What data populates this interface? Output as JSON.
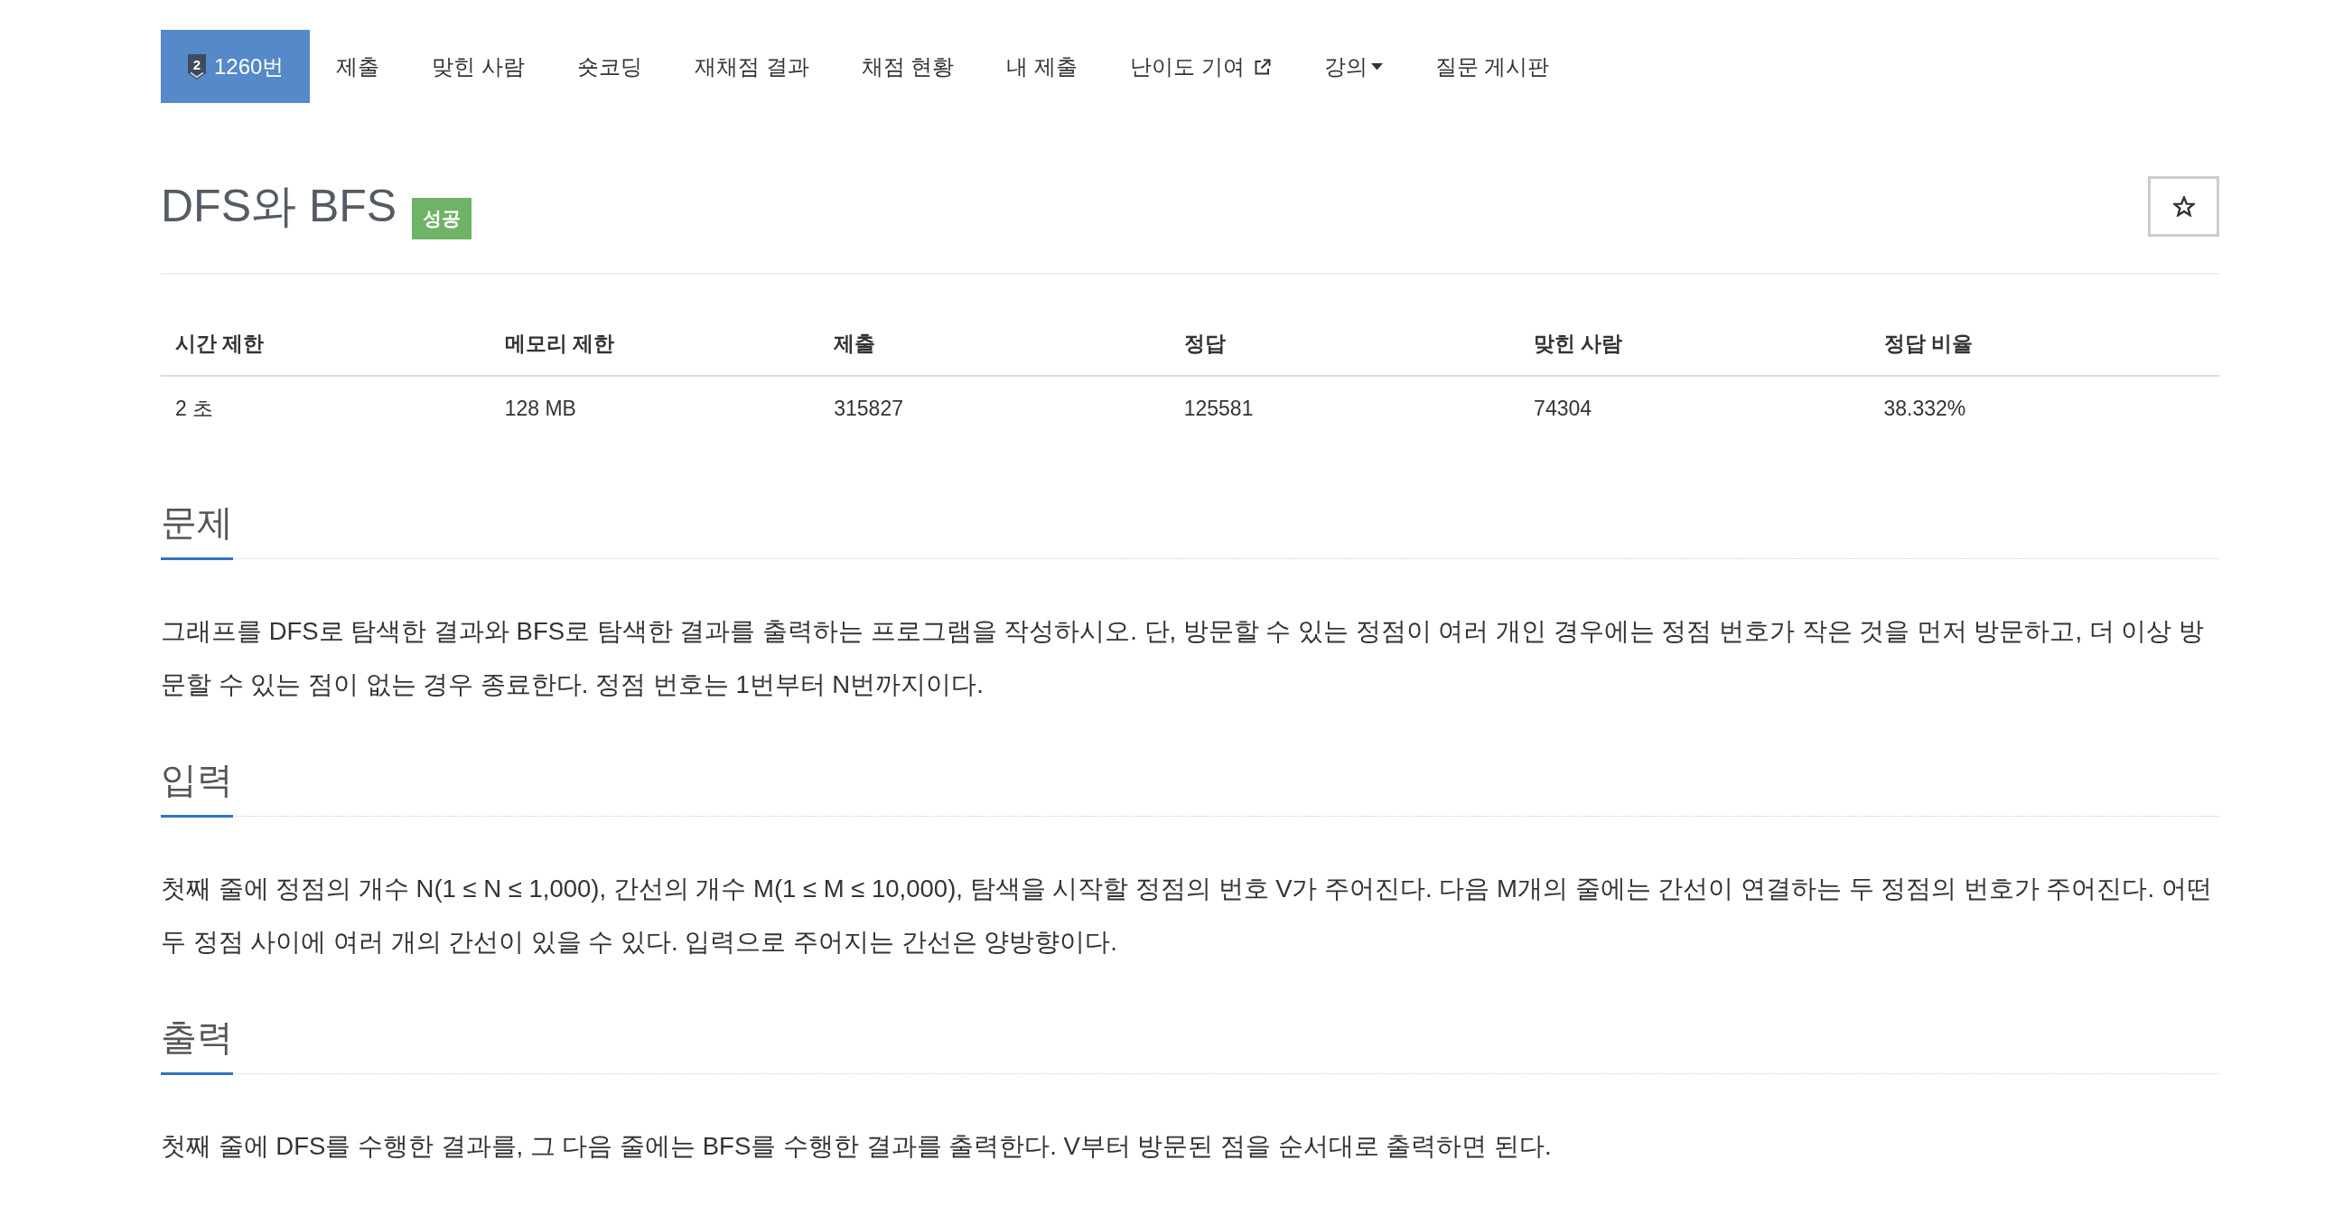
{
  "nav": {
    "items": [
      {
        "kind": "problem",
        "tier": "2",
        "label": "1260번",
        "selected": true
      },
      {
        "kind": "link",
        "label": "제출",
        "selected": false
      },
      {
        "kind": "link",
        "label": "맞힌 사람",
        "selected": false
      },
      {
        "kind": "link",
        "label": "숏코딩",
        "selected": false
      },
      {
        "kind": "link",
        "label": "재채점 결과",
        "selected": false
      },
      {
        "kind": "link",
        "label": "채점 현황",
        "selected": false
      },
      {
        "kind": "link",
        "label": "내 제출",
        "selected": false
      },
      {
        "kind": "external",
        "label": "난이도 기여",
        "selected": false
      },
      {
        "kind": "dropdown",
        "label": "강의",
        "selected": false
      },
      {
        "kind": "link",
        "label": "질문 게시판",
        "selected": false
      }
    ]
  },
  "problem": {
    "title": "DFS와 BFS",
    "result_label": "성공",
    "starred": false
  },
  "info_table": {
    "columns": [
      "시간 제한",
      "메모리 제한",
      "제출",
      "정답",
      "맞힌 사람",
      "정답 비율"
    ],
    "rows": [
      [
        "2 초",
        "128 MB",
        "315827",
        "125581",
        "74304",
        "38.332%"
      ]
    ]
  },
  "sections": [
    {
      "heading": "문제",
      "text": "그래프를 DFS로 탐색한 결과와 BFS로 탐색한 결과를 출력하는 프로그램을 작성하시오. 단, 방문할 수 있는 정점이 여러 개인 경우에는 정점 번호가 작은 것을 먼저 방문하고, 더 이상 방문할 수 있는 점이 없는 경우 종료한다. 정점 번호는 1번부터 N번까지이다."
    },
    {
      "heading": "입력",
      "text": "첫째 줄에 정점의 개수 N(1 ≤ N ≤ 1,000), 간선의 개수 M(1 ≤ M ≤ 10,000), 탐색을 시작할 정점의 번호 V가 주어진다. 다음 M개의 줄에는 간선이 연결하는 두 정점의 번호가 주어진다. 어떤 두 정점 사이에 여러 개의 간선이 있을 수 있다. 입력으로 주어지는 간선은 양방향이다."
    },
    {
      "heading": "출력",
      "text": "첫째 줄에 DFS를 수행한 결과를, 그 다음 줄에는 BFS를 수행한 결과를 출력한다. V부터 방문된 점을 순서대로 출력하면 된다."
    }
  ]
}
